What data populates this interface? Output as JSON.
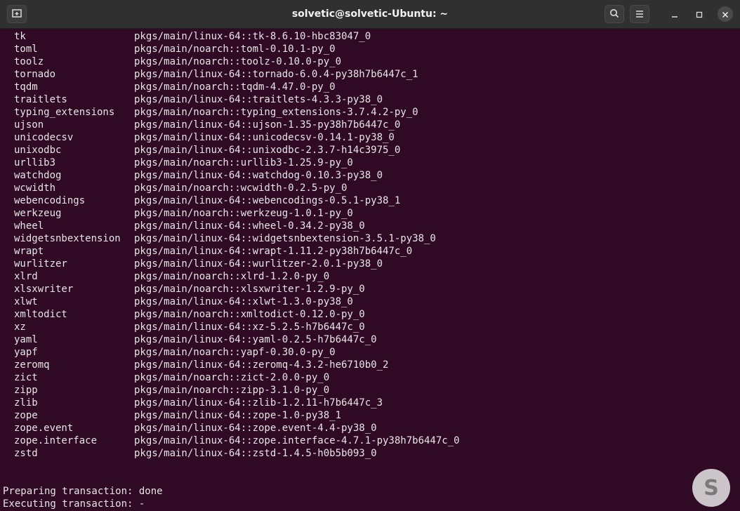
{
  "window": {
    "title": "solvetic@solvetic-Ubuntu: ~"
  },
  "icons": {
    "new_tab": "new-tab-icon",
    "search": "search-icon",
    "menu": "hamburger-menu-icon",
    "minimize": "minimize-icon",
    "maximize": "maximize-icon",
    "close": "close-icon",
    "watermark": "solvetic-logo"
  },
  "colors": {
    "terminal_bg": "#300a24",
    "titlebar_bg": "#303030",
    "text": "#e6e6e6"
  },
  "packages": [
    {
      "name": "tk",
      "channel": "pkgs/main/linux-64::tk-8.6.10-hbc83047_0"
    },
    {
      "name": "toml",
      "channel": "pkgs/main/noarch::toml-0.10.1-py_0"
    },
    {
      "name": "toolz",
      "channel": "pkgs/main/noarch::toolz-0.10.0-py_0"
    },
    {
      "name": "tornado",
      "channel": "pkgs/main/linux-64::tornado-6.0.4-py38h7b6447c_1"
    },
    {
      "name": "tqdm",
      "channel": "pkgs/main/noarch::tqdm-4.47.0-py_0"
    },
    {
      "name": "traitlets",
      "channel": "pkgs/main/linux-64::traitlets-4.3.3-py38_0"
    },
    {
      "name": "typing_extensions",
      "channel": "pkgs/main/noarch::typing_extensions-3.7.4.2-py_0"
    },
    {
      "name": "ujson",
      "channel": "pkgs/main/linux-64::ujson-1.35-py38h7b6447c_0"
    },
    {
      "name": "unicodecsv",
      "channel": "pkgs/main/linux-64::unicodecsv-0.14.1-py38_0"
    },
    {
      "name": "unixodbc",
      "channel": "pkgs/main/linux-64::unixodbc-2.3.7-h14c3975_0"
    },
    {
      "name": "urllib3",
      "channel": "pkgs/main/noarch::urllib3-1.25.9-py_0"
    },
    {
      "name": "watchdog",
      "channel": "pkgs/main/linux-64::watchdog-0.10.3-py38_0"
    },
    {
      "name": "wcwidth",
      "channel": "pkgs/main/noarch::wcwidth-0.2.5-py_0"
    },
    {
      "name": "webencodings",
      "channel": "pkgs/main/linux-64::webencodings-0.5.1-py38_1"
    },
    {
      "name": "werkzeug",
      "channel": "pkgs/main/noarch::werkzeug-1.0.1-py_0"
    },
    {
      "name": "wheel",
      "channel": "pkgs/main/linux-64::wheel-0.34.2-py38_0"
    },
    {
      "name": "widgetsnbextension",
      "channel": "pkgs/main/linux-64::widgetsnbextension-3.5.1-py38_0"
    },
    {
      "name": "wrapt",
      "channel": "pkgs/main/linux-64::wrapt-1.11.2-py38h7b6447c_0"
    },
    {
      "name": "wurlitzer",
      "channel": "pkgs/main/linux-64::wurlitzer-2.0.1-py38_0"
    },
    {
      "name": "xlrd",
      "channel": "pkgs/main/noarch::xlrd-1.2.0-py_0"
    },
    {
      "name": "xlsxwriter",
      "channel": "pkgs/main/noarch::xlsxwriter-1.2.9-py_0"
    },
    {
      "name": "xlwt",
      "channel": "pkgs/main/linux-64::xlwt-1.3.0-py38_0"
    },
    {
      "name": "xmltodict",
      "channel": "pkgs/main/noarch::xmltodict-0.12.0-py_0"
    },
    {
      "name": "xz",
      "channel": "pkgs/main/linux-64::xz-5.2.5-h7b6447c_0"
    },
    {
      "name": "yaml",
      "channel": "pkgs/main/linux-64::yaml-0.2.5-h7b6447c_0"
    },
    {
      "name": "yapf",
      "channel": "pkgs/main/noarch::yapf-0.30.0-py_0"
    },
    {
      "name": "zeromq",
      "channel": "pkgs/main/linux-64::zeromq-4.3.2-he6710b0_2"
    },
    {
      "name": "zict",
      "channel": "pkgs/main/noarch::zict-2.0.0-py_0"
    },
    {
      "name": "zipp",
      "channel": "pkgs/main/noarch::zipp-3.1.0-py_0"
    },
    {
      "name": "zlib",
      "channel": "pkgs/main/linux-64::zlib-1.2.11-h7b6447c_3"
    },
    {
      "name": "zope",
      "channel": "pkgs/main/linux-64::zope-1.0-py38_1"
    },
    {
      "name": "zope.event",
      "channel": "pkgs/main/linux-64::zope.event-4.4-py38_0"
    },
    {
      "name": "zope.interface",
      "channel": "pkgs/main/linux-64::zope.interface-4.7.1-py38h7b6447c_0"
    },
    {
      "name": "zstd",
      "channel": "pkgs/main/linux-64::zstd-1.4.5-h0b5b093_0"
    }
  ],
  "status": {
    "preparing": "Preparing transaction: done",
    "executing": "Executing transaction: -"
  },
  "watermark": {
    "letter": "S"
  }
}
